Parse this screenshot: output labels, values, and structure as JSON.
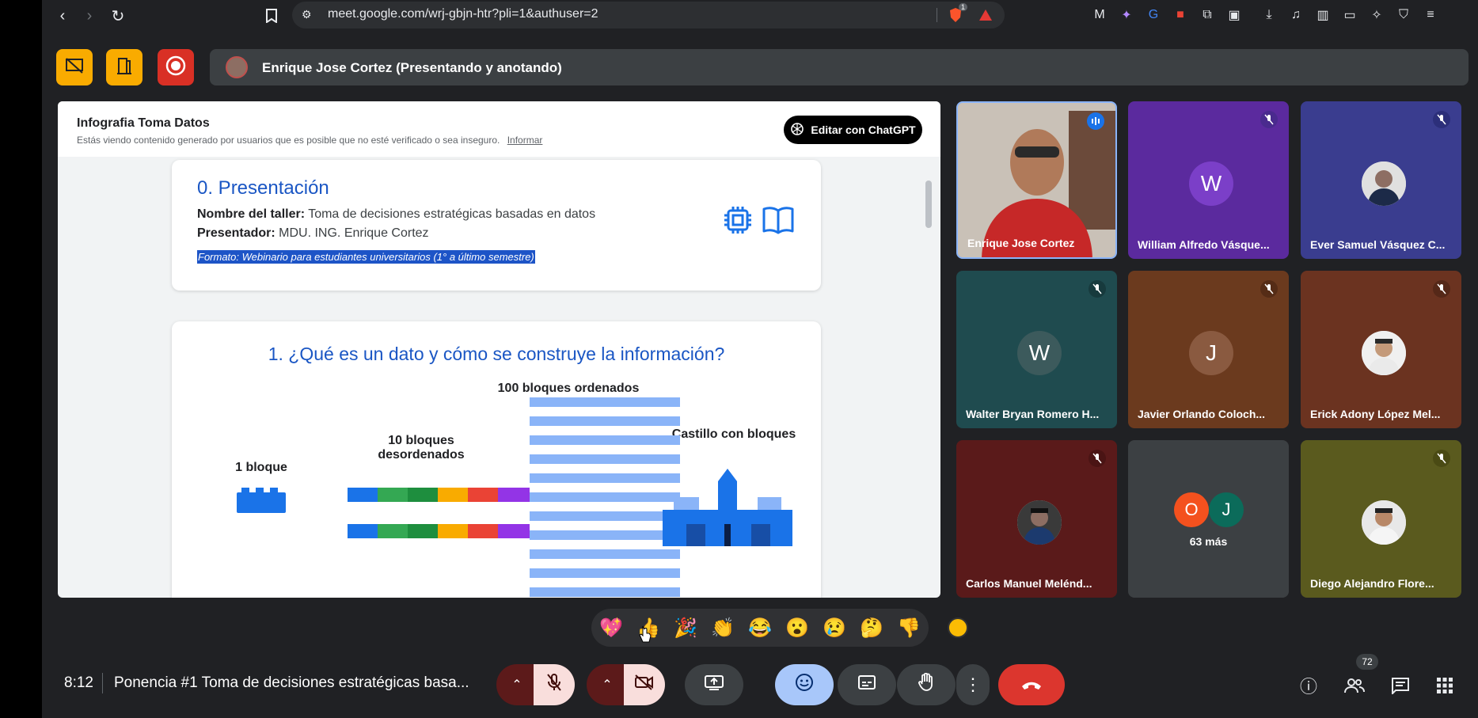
{
  "browser": {
    "url": "meet.google.com/wrj-gbjn-htr?pli=1&authuser=2",
    "brave_badge": "1"
  },
  "meet_top": {
    "presenter_label": "Enrique Jose Cortez (Presentando y anotando)"
  },
  "presentation": {
    "title": "Infografia Toma Datos",
    "warning": "Estás viendo contenido generado por usuarios que es posible que no esté verificado o sea inseguro.",
    "report_link": "Informar",
    "edit_button": "Editar con ChatGPT",
    "section0": {
      "heading": "0. Presentación",
      "taller_label": "Nombre del taller:",
      "taller_value": "Toma de decisiones estratégicas basadas en datos",
      "presenter_label": "Presentador:",
      "presenter_value": "MDU. ING. Enrique Cortez",
      "format_line": "Formato: Webinario para estudiantes universitarios (1° a último semestre)"
    },
    "section1": {
      "heading": "1. ¿Qué es un dato y cómo se construye la información?",
      "label_1": "1 bloque",
      "label_10": "10 bloques desordenados",
      "label_100": "100 bloques ordenados",
      "label_castle": "Castillo con bloques"
    }
  },
  "participants": [
    {
      "name": "Enrique Jose Cortez",
      "type": "video",
      "speaking": true
    },
    {
      "name": "William Alfredo Vásque...",
      "type": "letter",
      "letter": "W",
      "bg": "#5b2a9e",
      "muted": true
    },
    {
      "name": "Ever Samuel Vásquez C...",
      "type": "photo",
      "bg": "#3a3d8f",
      "muted": true
    },
    {
      "name": "Walter Bryan Romero H...",
      "type": "letter",
      "letter": "W",
      "bg": "#1f4b4f",
      "muted": true
    },
    {
      "name": "Javier Orlando Coloch...",
      "type": "letter",
      "letter": "J",
      "bg": "#6b3a1e",
      "muted": true
    },
    {
      "name": "Erick Adony López Mel...",
      "type": "photo",
      "bg": "#6b3320",
      "muted": true
    },
    {
      "name": "Carlos Manuel Melénd...",
      "type": "photo",
      "bg": "#5a1a1a",
      "muted": true
    },
    {
      "name": "63 más",
      "type": "more",
      "letters": [
        "O",
        "J"
      ]
    },
    {
      "name": "Diego Alejandro Flore...",
      "type": "photo",
      "bg": "#5a5a1e",
      "muted": true
    }
  ],
  "reactions": [
    "💖",
    "👍",
    "🎉",
    "👏",
    "😂",
    "😮",
    "😢",
    "🤔",
    "👎"
  ],
  "bottom": {
    "time": "8:12",
    "meeting_title": "Ponencia #1 Toma de decisiones estratégicas basa...",
    "people_count": "72"
  }
}
